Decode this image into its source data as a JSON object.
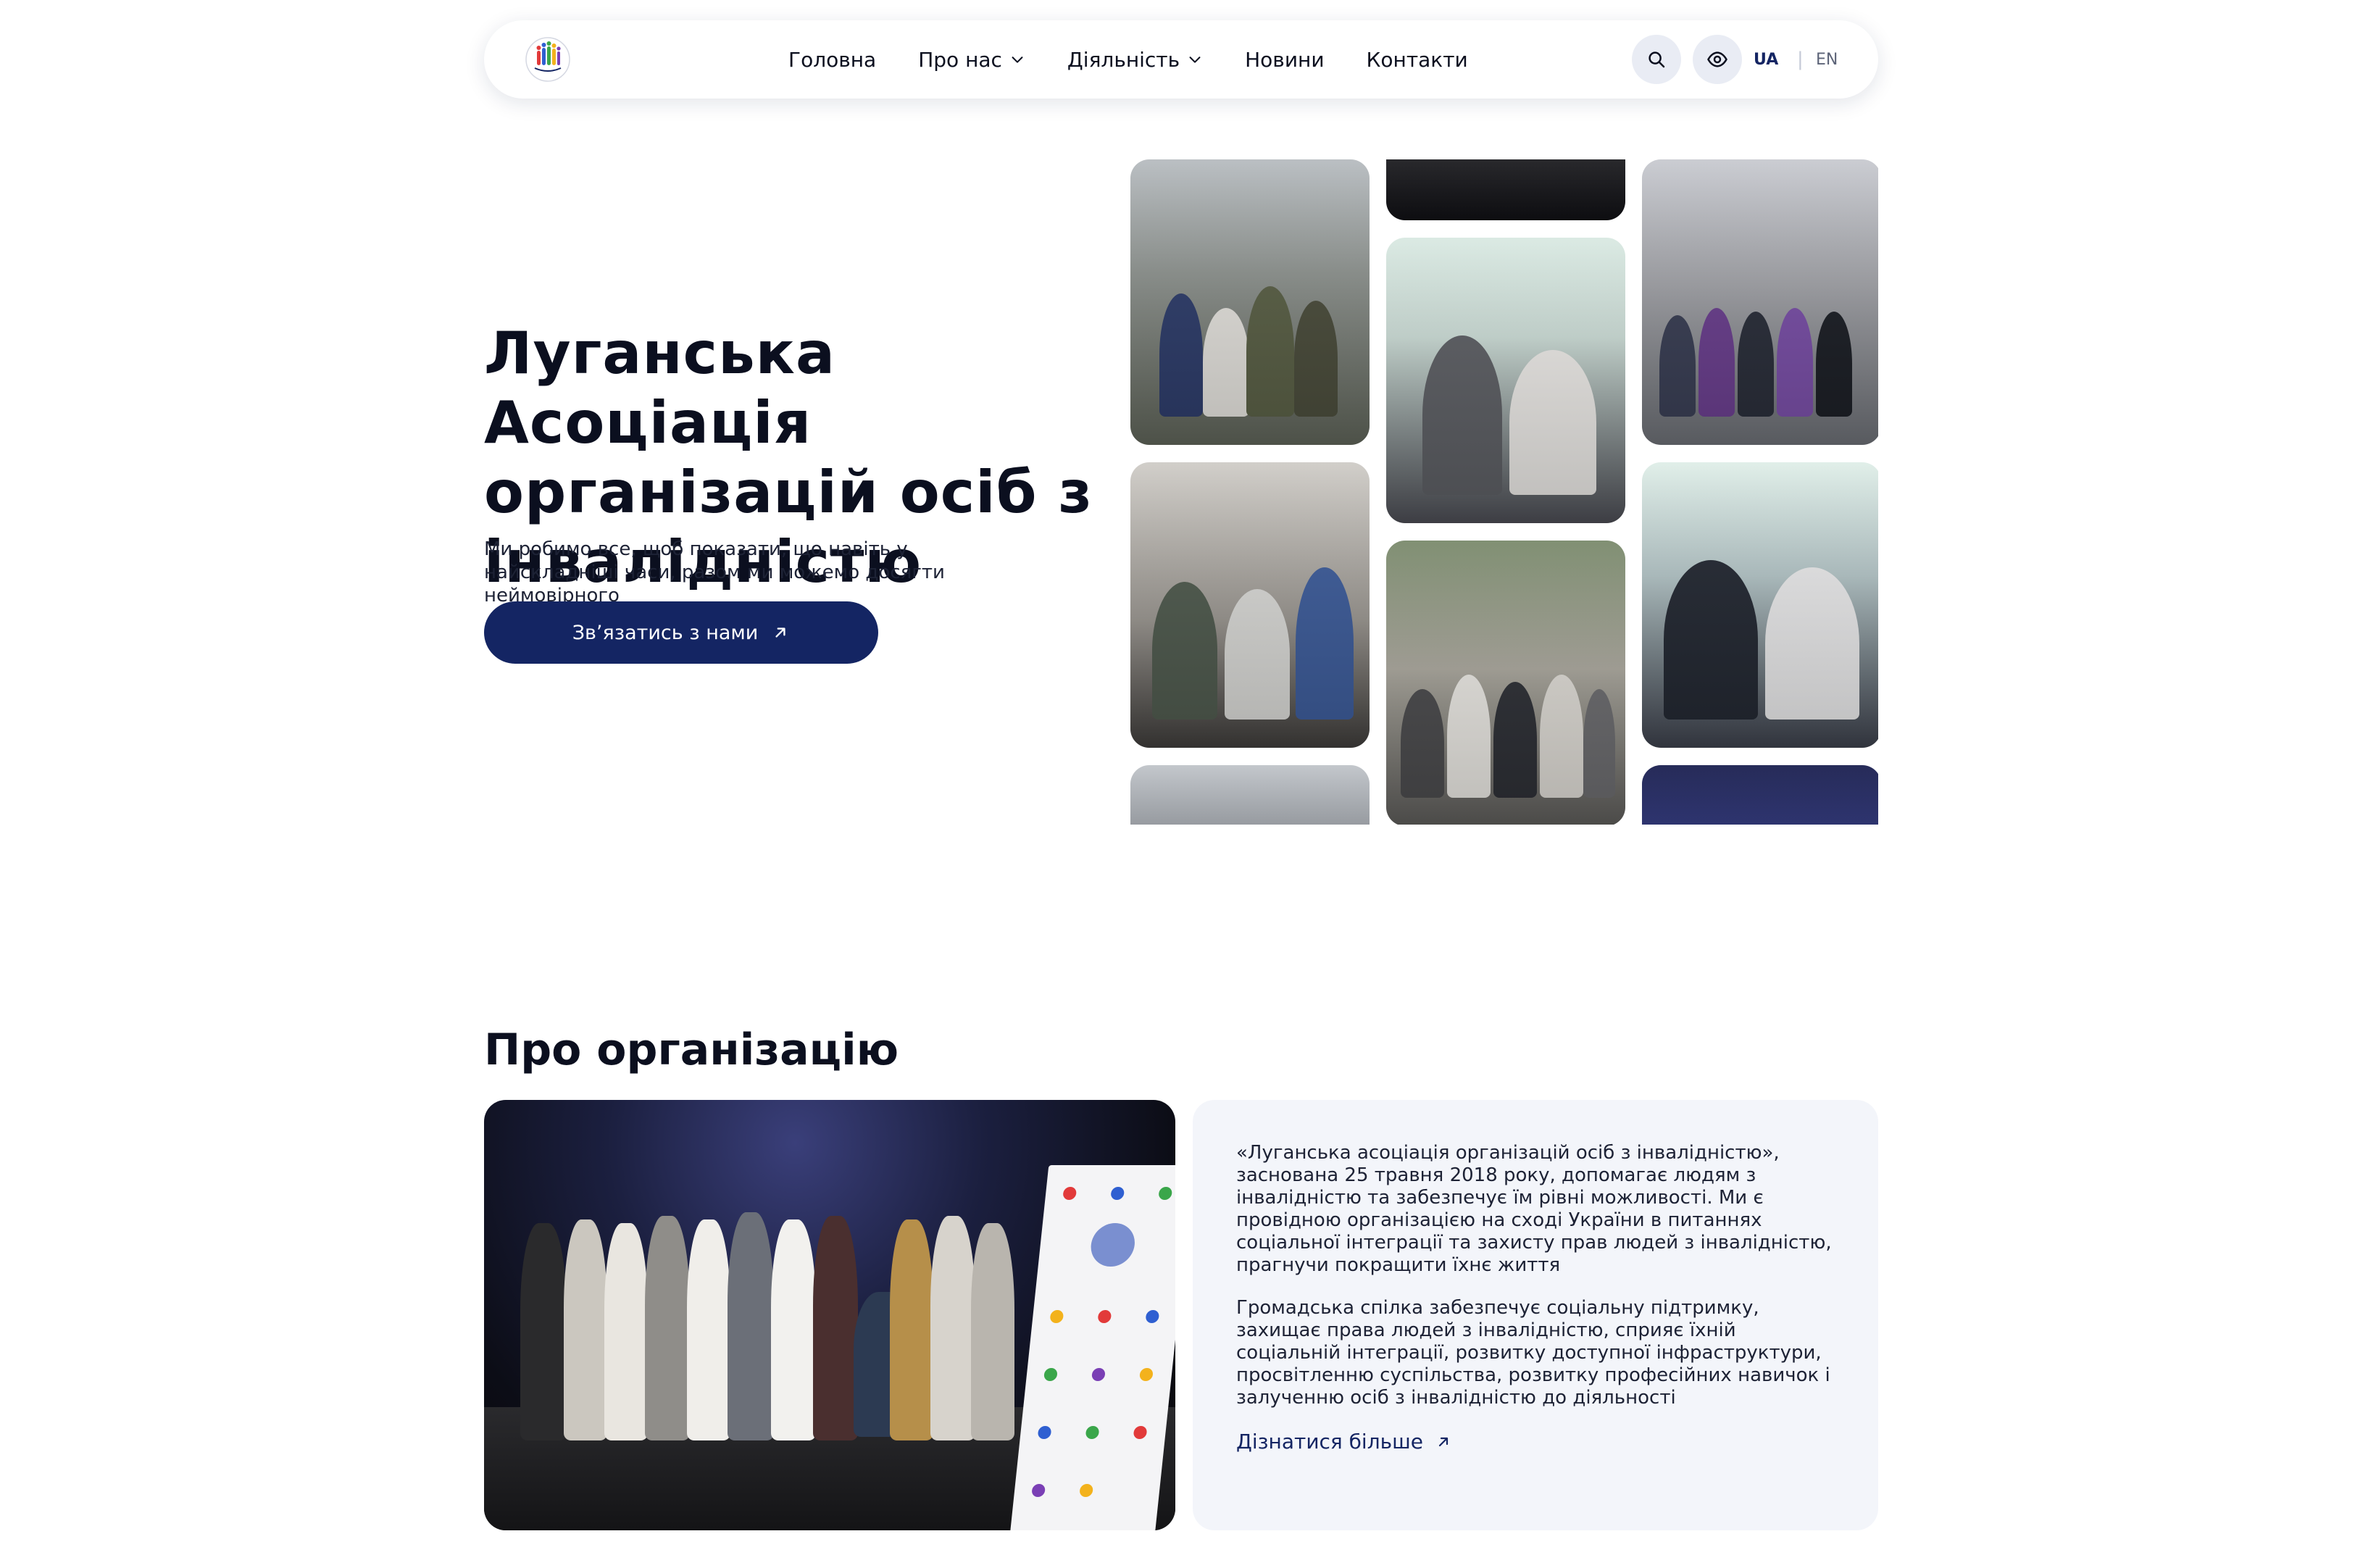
{
  "nav": {
    "logo_alt": "ЛАООІ",
    "items": [
      {
        "label": "Головна",
        "has_dropdown": false
      },
      {
        "label": "Про нас",
        "has_dropdown": true
      },
      {
        "label": "Діяльність",
        "has_dropdown": true
      },
      {
        "label": "Новини",
        "has_dropdown": false
      },
      {
        "label": "Контакти",
        "has_dropdown": false
      }
    ],
    "search_icon": "search-icon",
    "accessibility_icon": "eye-icon",
    "languages": {
      "ua": "UA",
      "separator": "|",
      "en": "EN",
      "active": "UA"
    }
  },
  "hero": {
    "title": "Луганська Асоціація організацій осіб з інвалідністю",
    "subtitle": "Ми робимо все, щоб показати, що навіть у найскладніші часи, разом ми можемо досягти неймовірного",
    "cta_label": "Зв’язатись з нами",
    "cta_icon": "arrow-up-right-icon"
  },
  "about": {
    "title": "Про організацію",
    "paragraph_1": "«Луганська асоціація організацій осіб з інвалідністю», заснована 25 травня 2018 року, допомагає людям з інвалідністю та забезпечує їм рівні можливості. Ми є провідною організацією на сході України в питаннях соціальної інтеграції та захисту прав людей з інвалідністю, прагнучи покращити їхнє життя",
    "paragraph_2": "Громадська спілка забезпечує соціальну підтримку, захищає права людей з інвалідністю, сприяє їхній соціальній інтеграції, розвитку доступної інфраструктури, просвітленню суспільства, розвитку професійних навичок і залученню осіб з інвалідністю до діяльності",
    "more_label": "Дізнатися більше",
    "more_icon": "arrow-up-right-icon"
  },
  "colors": {
    "primary": "#142563",
    "card_bg": "#f3f5fa",
    "nav_circle_bg": "#e9ecf4",
    "text": "#0b0f1f"
  }
}
